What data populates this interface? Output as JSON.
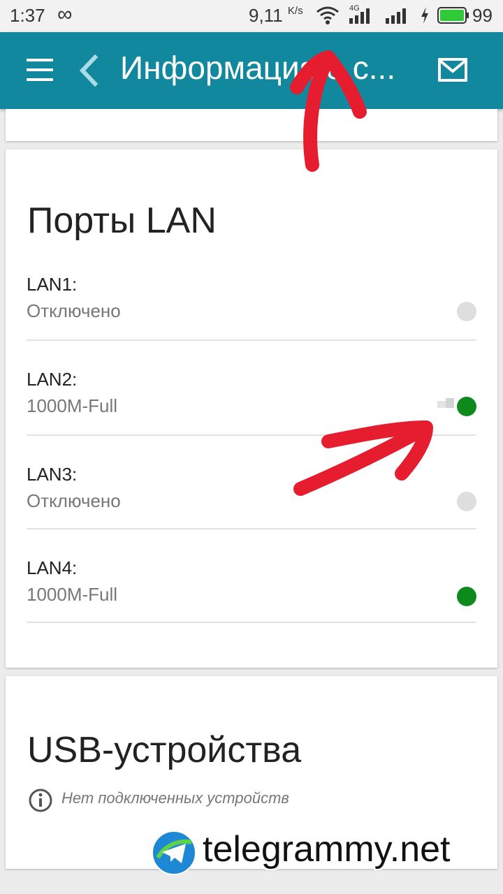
{
  "status_bar": {
    "time": "1:37",
    "infinity": "∞",
    "speed": "9,11",
    "speed_unit": "K/s",
    "network": "4G",
    "battery": "99"
  },
  "app_bar": {
    "title": "Информация о с...",
    "menu_icon": "menu-icon",
    "back_icon": "back-icon",
    "mail_icon": "mail-icon",
    "color": "#12889e"
  },
  "lan": {
    "title": "Порты LAN",
    "ports": [
      {
        "name": "LAN1:",
        "status": "Отключено",
        "state": "off"
      },
      {
        "name": "LAN2:",
        "status": "1000M-Full",
        "state": "on"
      },
      {
        "name": "LAN3:",
        "status": "Отключено",
        "state": "off"
      },
      {
        "name": "LAN4:",
        "status": "1000M-Full",
        "state": "on"
      }
    ],
    "on_color": "#0e8a1c",
    "off_color": "#dedede"
  },
  "usb": {
    "title": "USB-устройства",
    "empty_text": "Нет подключенных устройств",
    "info_icon": "info-icon"
  },
  "watermark": {
    "text": "telegrammy.net",
    "logo": "telegram-logo"
  }
}
